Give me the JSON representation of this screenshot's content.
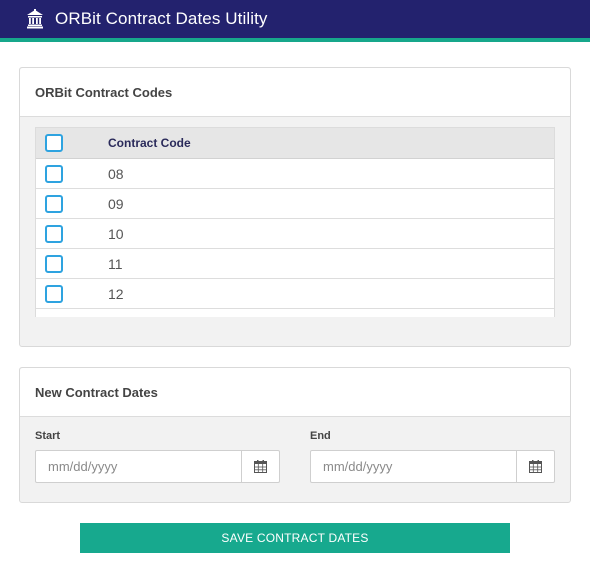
{
  "header": {
    "title": "ORBit Contract Dates Utility",
    "logo_icon": "bank-building-icon",
    "bg_color": "#23226e",
    "accent_color": "#17a78b"
  },
  "codes_panel": {
    "title": "ORBit Contract Codes",
    "table": {
      "column_header": "Contract Code",
      "rows": [
        {
          "code": "08",
          "checked": false
        },
        {
          "code": "09",
          "checked": false
        },
        {
          "code": "10",
          "checked": false
        },
        {
          "code": "11",
          "checked": false
        },
        {
          "code": "12",
          "checked": false
        }
      ]
    }
  },
  "dates_panel": {
    "title": "New Contract Dates",
    "start": {
      "label": "Start",
      "placeholder": "mm/dd/yyyy",
      "value": "",
      "icon": "calendar-icon"
    },
    "end": {
      "label": "End",
      "placeholder": "mm/dd/yyyy",
      "value": "",
      "icon": "calendar-icon"
    }
  },
  "save_button": {
    "label": "SAVE CONTRACT DATES",
    "color": "#17a98e"
  },
  "checkbox_color": "#2ea3e0"
}
